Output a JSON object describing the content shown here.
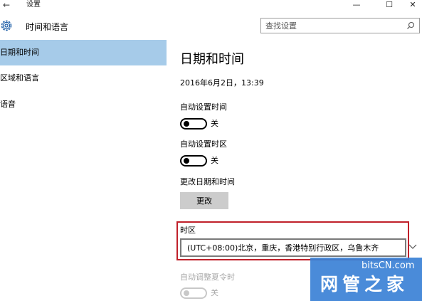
{
  "window": {
    "title": "设置",
    "back": "←",
    "minimize": "—",
    "maximize": "☐",
    "close": "✕"
  },
  "header": {
    "section_title": "时间和语言",
    "search_placeholder": "查找设置"
  },
  "sidebar": {
    "items": [
      {
        "label": "日期和时间",
        "selected": true
      },
      {
        "label": "区域和语言",
        "selected": false
      },
      {
        "label": "语音",
        "selected": false
      }
    ]
  },
  "main": {
    "title": "日期和时间",
    "datetime": "2016年6月2日，13:39",
    "auto_time": {
      "label": "自动设置时间",
      "state": "关"
    },
    "auto_timezone": {
      "label": "自动设置时区",
      "state": "关"
    },
    "change_datetime": {
      "label": "更改日期和时间",
      "button": "更改"
    },
    "timezone": {
      "label": "时区",
      "value": "(UTC+08:00)北京，重庆，香港特别行政区，乌鲁木齐"
    },
    "dst": {
      "label": "自动调整夏令时",
      "state": "关"
    }
  },
  "watermark": {
    "top": "bitsCN.com",
    "bottom": "网管之家"
  },
  "colors": {
    "selected_nav": "#a6cbe9",
    "highlight_border": "#c0202a",
    "button_bg": "#cccccc",
    "watermark_bg": "#3b82d6"
  }
}
